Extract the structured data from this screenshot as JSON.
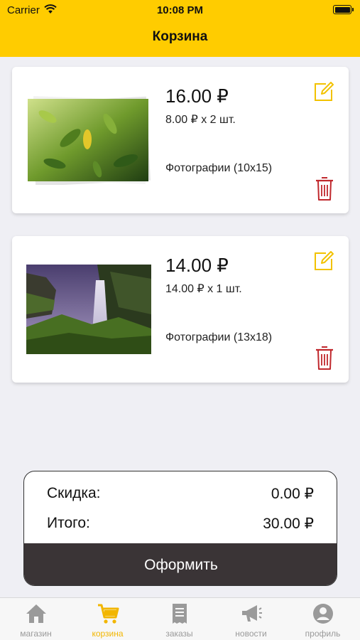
{
  "status_bar": {
    "carrier": "Carrier",
    "time": "10:08 PM"
  },
  "nav": {
    "title": "Корзина"
  },
  "cart": {
    "items": [
      {
        "price": "16.00 ₽",
        "quantity": "8.00 ₽ x 2 шт.",
        "product": "Фотографии (10x15)"
      },
      {
        "price": "14.00 ₽",
        "quantity": "14.00 ₽ x 1 шт.",
        "product": "Фотографии (13x18)"
      }
    ]
  },
  "summary": {
    "discount_label": "Скидка:",
    "discount_value": "0.00 ₽",
    "total_label": "Итого:",
    "total_value": "30.00 ₽",
    "checkout_label": "Оформить"
  },
  "tabs": [
    {
      "label": "магазин",
      "icon": "home-icon"
    },
    {
      "label": "корзина",
      "icon": "cart-icon",
      "active": true
    },
    {
      "label": "заказы",
      "icon": "orders-icon"
    },
    {
      "label": "новости",
      "icon": "megaphone-icon"
    },
    {
      "label": "профиль",
      "icon": "profile-icon"
    }
  ],
  "colors": {
    "accent": "#ffcc00",
    "active_tab": "#f2b600",
    "delete": "#c0282d",
    "checkout_bg": "#3a3436",
    "inactive_tab": "#9a9a9a"
  }
}
